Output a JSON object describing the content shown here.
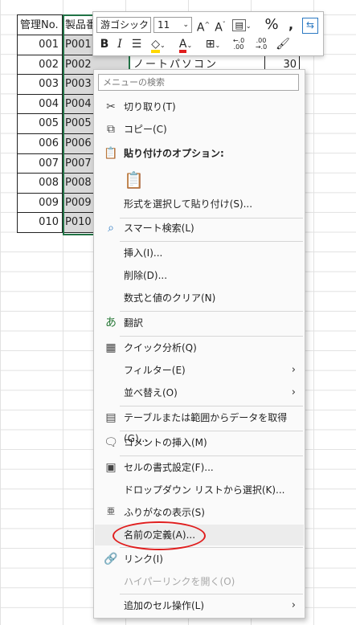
{
  "sheet": {
    "headers": {
      "a": "管理No.",
      "b": "製品番"
    },
    "rows": [
      {
        "a": "001",
        "b": "P001"
      },
      {
        "a": "002",
        "b": "P002",
        "c": "ノートパソコン",
        "d": "30"
      },
      {
        "a": "003",
        "b": "P003"
      },
      {
        "a": "004",
        "b": "P004"
      },
      {
        "a": "005",
        "b": "P005"
      },
      {
        "a": "006",
        "b": "P006"
      },
      {
        "a": "007",
        "b": "P007"
      },
      {
        "a": "008",
        "b": "P008"
      },
      {
        "a": "009",
        "b": "P009"
      },
      {
        "a": "010",
        "b": "P010"
      }
    ]
  },
  "mini_toolbar": {
    "font_name": "游ゴシック",
    "font_size": "11",
    "grow": "A^",
    "shrink": "Aˇ",
    "percent": "%",
    "comma": "9",
    "bold": "B",
    "italic": "I",
    "font_color": "A",
    "inc_decimal": "←.0\n.00",
    "dec_decimal": ".00\n→.0"
  },
  "menu": {
    "search_placeholder": "メニューの検索",
    "items": {
      "cut": "切り取り(T)",
      "copy": "コピー(C)",
      "paste_options": "貼り付けのオプション:",
      "paste_special": "形式を選択して貼り付け(S)...",
      "smart_lookup": "スマート検索(L)",
      "insert": "挿入(I)...",
      "delete": "削除(D)...",
      "clear": "数式と値のクリア(N)",
      "translate": "翻訳",
      "quick_analysis": "クイック分析(Q)",
      "filter": "フィルター(E)",
      "sort": "並べ替え(O)",
      "get_data": "テーブルまたは範囲からデータを取得(G)...",
      "insert_comment": "コメントの挿入(M)",
      "format_cells": "セルの書式設定(F)...",
      "pick_list": "ドロップダウン リストから選択(K)...",
      "phonetic": "ふりがなの表示(S)",
      "define_name": "名前の定義(A)...",
      "link": "リンク(I)",
      "open_hyperlink": "ハイパーリンクを開く(O)",
      "more_actions": "追加のセル操作(L)"
    },
    "submenu_arrow": "›"
  },
  "colors": {
    "highlight_oval": "#e01e1e",
    "selection": "#217346",
    "fill_yellow": "#ffd800",
    "font_red": "#e01e1e"
  }
}
